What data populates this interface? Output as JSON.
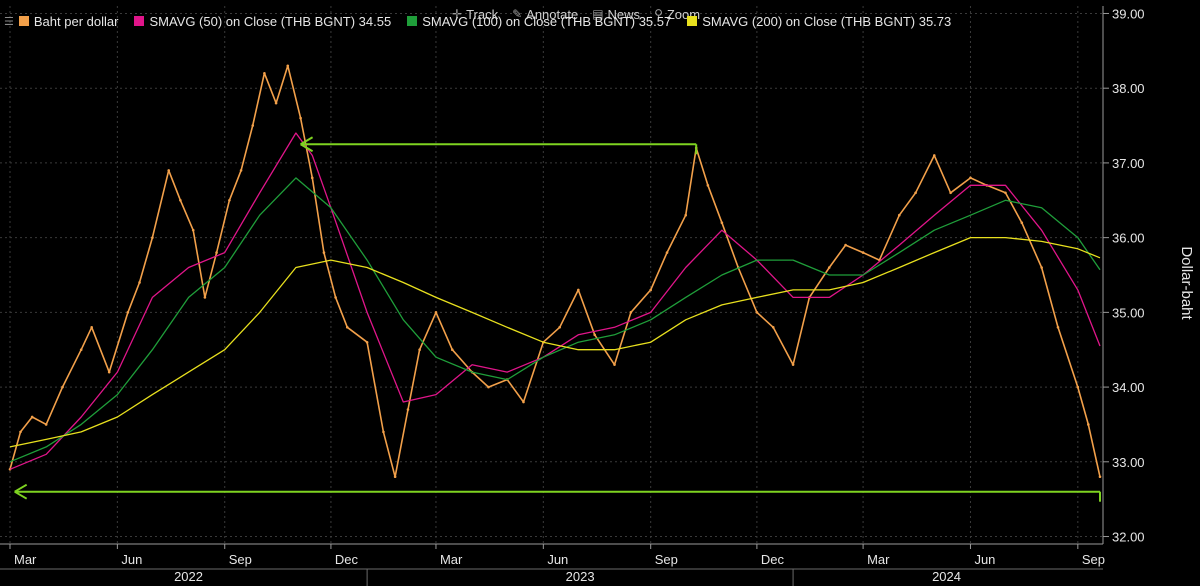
{
  "toolbar": {
    "track": "Track",
    "annotate": "Annotate",
    "news": "News",
    "zoom": "Zoom"
  },
  "legend": [
    {
      "label": "Baht per dollar",
      "color": "#f2a04a"
    },
    {
      "label": "SMAVG (50)  on Close (THB BGNT) 34.55",
      "color": "#e0158a"
    },
    {
      "label": "SMAVG (100)  on Close (THB BGNT) 35.57",
      "color": "#1f9e3a"
    },
    {
      "label": "SMAVG (200)  on Close (THB BGNT) 35.73",
      "color": "#e8e01e"
    }
  ],
  "chart_data": {
    "type": "line",
    "ylabel": "Dollar-baht",
    "ylim": [
      31.9,
      39.1
    ],
    "y_ticks": [
      "32.00",
      "33.00",
      "34.00",
      "35.00",
      "36.00",
      "37.00",
      "38.00",
      "39.00"
    ],
    "x_range": [
      "2022-03-01",
      "2024-09-20"
    ],
    "x_month_ticks": [
      {
        "date": "2022-03-01",
        "label": "Mar"
      },
      {
        "date": "2022-06-01",
        "label": "Jun"
      },
      {
        "date": "2022-09-01",
        "label": "Sep"
      },
      {
        "date": "2022-12-01",
        "label": "Dec"
      },
      {
        "date": "2023-03-01",
        "label": "Mar"
      },
      {
        "date": "2023-06-01",
        "label": "Jun"
      },
      {
        "date": "2023-09-01",
        "label": "Sep"
      },
      {
        "date": "2023-12-01",
        "label": "Dec"
      },
      {
        "date": "2024-03-01",
        "label": "Mar"
      },
      {
        "date": "2024-06-01",
        "label": "Jun"
      },
      {
        "date": "2024-09-01",
        "label": "Sep"
      }
    ],
    "x_year_labels": [
      {
        "label": "2022",
        "from": "2022-03-01",
        "to": "2023-01-01"
      },
      {
        "label": "2023",
        "from": "2023-01-01",
        "to": "2024-01-01"
      },
      {
        "label": "2024",
        "from": "2024-01-01",
        "to": "2024-09-20"
      }
    ],
    "series": [
      {
        "name": "Baht per dollar",
        "color": "#f2a04a",
        "points": [
          [
            "2022-03-01",
            32.9
          ],
          [
            "2022-03-10",
            33.4
          ],
          [
            "2022-03-20",
            33.6
          ],
          [
            "2022-04-01",
            33.5
          ],
          [
            "2022-04-15",
            34.0
          ],
          [
            "2022-05-01",
            34.5
          ],
          [
            "2022-05-10",
            34.8
          ],
          [
            "2022-05-25",
            34.2
          ],
          [
            "2022-06-10",
            35.0
          ],
          [
            "2022-06-20",
            35.4
          ],
          [
            "2022-07-01",
            36.0
          ],
          [
            "2022-07-15",
            36.9
          ],
          [
            "2022-07-25",
            36.5
          ],
          [
            "2022-08-05",
            36.1
          ],
          [
            "2022-08-15",
            35.2
          ],
          [
            "2022-08-25",
            35.8
          ],
          [
            "2022-09-05",
            36.5
          ],
          [
            "2022-09-15",
            36.9
          ],
          [
            "2022-09-25",
            37.5
          ],
          [
            "2022-10-05",
            38.2
          ],
          [
            "2022-10-15",
            37.8
          ],
          [
            "2022-10-25",
            38.3
          ],
          [
            "2022-11-05",
            37.6
          ],
          [
            "2022-11-15",
            36.8
          ],
          [
            "2022-11-25",
            35.8
          ],
          [
            "2022-12-05",
            35.2
          ],
          [
            "2022-12-15",
            34.8
          ],
          [
            "2023-01-01",
            34.6
          ],
          [
            "2023-01-15",
            33.4
          ],
          [
            "2023-01-25",
            32.8
          ],
          [
            "2023-02-05",
            33.7
          ],
          [
            "2023-02-15",
            34.5
          ],
          [
            "2023-03-01",
            35.0
          ],
          [
            "2023-03-15",
            34.5
          ],
          [
            "2023-04-01",
            34.2
          ],
          [
            "2023-04-15",
            34.0
          ],
          [
            "2023-05-01",
            34.1
          ],
          [
            "2023-05-15",
            33.8
          ],
          [
            "2023-06-01",
            34.6
          ],
          [
            "2023-06-15",
            34.8
          ],
          [
            "2023-07-01",
            35.3
          ],
          [
            "2023-07-15",
            34.7
          ],
          [
            "2023-08-01",
            34.3
          ],
          [
            "2023-08-15",
            35.0
          ],
          [
            "2023-09-01",
            35.3
          ],
          [
            "2023-09-15",
            35.8
          ],
          [
            "2023-10-01",
            36.3
          ],
          [
            "2023-10-10",
            37.2
          ],
          [
            "2023-10-20",
            36.7
          ],
          [
            "2023-11-01",
            36.2
          ],
          [
            "2023-11-15",
            35.6
          ],
          [
            "2023-12-01",
            35.0
          ],
          [
            "2023-12-15",
            34.8
          ],
          [
            "2024-01-01",
            34.3
          ],
          [
            "2024-01-15",
            35.2
          ],
          [
            "2024-02-01",
            35.6
          ],
          [
            "2024-02-15",
            35.9
          ],
          [
            "2024-03-01",
            35.8
          ],
          [
            "2024-03-15",
            35.7
          ],
          [
            "2024-04-01",
            36.3
          ],
          [
            "2024-04-15",
            36.6
          ],
          [
            "2024-05-01",
            37.1
          ],
          [
            "2024-05-15",
            36.6
          ],
          [
            "2024-06-01",
            36.8
          ],
          [
            "2024-06-15",
            36.7
          ],
          [
            "2024-07-01",
            36.6
          ],
          [
            "2024-07-15",
            36.2
          ],
          [
            "2024-08-01",
            35.6
          ],
          [
            "2024-08-15",
            34.8
          ],
          [
            "2024-09-01",
            34.0
          ],
          [
            "2024-09-10",
            33.5
          ],
          [
            "2024-09-20",
            32.8
          ]
        ]
      },
      {
        "name": "SMAVG (50)  on Close (THB BGNT) 34.55",
        "color": "#e0158a",
        "points": [
          [
            "2022-03-01",
            32.9
          ],
          [
            "2022-04-01",
            33.1
          ],
          [
            "2022-05-01",
            33.6
          ],
          [
            "2022-06-01",
            34.2
          ],
          [
            "2022-07-01",
            35.2
          ],
          [
            "2022-08-01",
            35.6
          ],
          [
            "2022-09-01",
            35.8
          ],
          [
            "2022-10-01",
            36.6
          ],
          [
            "2022-11-01",
            37.4
          ],
          [
            "2022-11-15",
            37.1
          ],
          [
            "2022-12-01",
            36.4
          ],
          [
            "2023-01-01",
            35.0
          ],
          [
            "2023-02-01",
            33.8
          ],
          [
            "2023-03-01",
            33.9
          ],
          [
            "2023-04-01",
            34.3
          ],
          [
            "2023-05-01",
            34.2
          ],
          [
            "2023-06-01",
            34.4
          ],
          [
            "2023-07-01",
            34.7
          ],
          [
            "2023-08-01",
            34.8
          ],
          [
            "2023-09-01",
            35.0
          ],
          [
            "2023-10-01",
            35.6
          ],
          [
            "2023-11-01",
            36.1
          ],
          [
            "2023-12-01",
            35.7
          ],
          [
            "2024-01-01",
            35.2
          ],
          [
            "2024-02-01",
            35.2
          ],
          [
            "2024-03-01",
            35.5
          ],
          [
            "2024-04-01",
            35.9
          ],
          [
            "2024-05-01",
            36.3
          ],
          [
            "2024-06-01",
            36.7
          ],
          [
            "2024-07-01",
            36.7
          ],
          [
            "2024-08-01",
            36.1
          ],
          [
            "2024-09-01",
            35.3
          ],
          [
            "2024-09-20",
            34.55
          ]
        ]
      },
      {
        "name": "SMAVG (100)  on Close (THB BGNT) 35.57",
        "color": "#1f9e3a",
        "points": [
          [
            "2022-03-01",
            33.0
          ],
          [
            "2022-04-01",
            33.2
          ],
          [
            "2022-05-01",
            33.5
          ],
          [
            "2022-06-01",
            33.9
          ],
          [
            "2022-07-01",
            34.5
          ],
          [
            "2022-08-01",
            35.2
          ],
          [
            "2022-09-01",
            35.6
          ],
          [
            "2022-10-01",
            36.3
          ],
          [
            "2022-11-01",
            36.8
          ],
          [
            "2022-12-01",
            36.4
          ],
          [
            "2023-01-01",
            35.7
          ],
          [
            "2023-02-01",
            34.9
          ],
          [
            "2023-03-01",
            34.4
          ],
          [
            "2023-04-01",
            34.2
          ],
          [
            "2023-05-01",
            34.1
          ],
          [
            "2023-06-01",
            34.4
          ],
          [
            "2023-07-01",
            34.6
          ],
          [
            "2023-08-01",
            34.7
          ],
          [
            "2023-09-01",
            34.9
          ],
          [
            "2023-10-01",
            35.2
          ],
          [
            "2023-11-01",
            35.5
          ],
          [
            "2023-12-01",
            35.7
          ],
          [
            "2024-01-01",
            35.7
          ],
          [
            "2024-02-01",
            35.5
          ],
          [
            "2024-03-01",
            35.5
          ],
          [
            "2024-04-01",
            35.8
          ],
          [
            "2024-05-01",
            36.1
          ],
          [
            "2024-06-01",
            36.3
          ],
          [
            "2024-07-01",
            36.5
          ],
          [
            "2024-08-01",
            36.4
          ],
          [
            "2024-09-01",
            36.0
          ],
          [
            "2024-09-20",
            35.57
          ]
        ]
      },
      {
        "name": "SMAVG (200)  on Close (THB BGNT) 35.73",
        "color": "#e8e01e",
        "points": [
          [
            "2022-03-01",
            33.2
          ],
          [
            "2022-04-01",
            33.3
          ],
          [
            "2022-05-01",
            33.4
          ],
          [
            "2022-06-01",
            33.6
          ],
          [
            "2022-07-01",
            33.9
          ],
          [
            "2022-08-01",
            34.2
          ],
          [
            "2022-09-01",
            34.5
          ],
          [
            "2022-10-01",
            35.0
          ],
          [
            "2022-11-01",
            35.6
          ],
          [
            "2022-12-01",
            35.7
          ],
          [
            "2023-01-01",
            35.6
          ],
          [
            "2023-02-01",
            35.4
          ],
          [
            "2023-03-01",
            35.2
          ],
          [
            "2023-04-01",
            35.0
          ],
          [
            "2023-05-01",
            34.8
          ],
          [
            "2023-06-01",
            34.6
          ],
          [
            "2023-07-01",
            34.5
          ],
          [
            "2023-08-01",
            34.5
          ],
          [
            "2023-09-01",
            34.6
          ],
          [
            "2023-10-01",
            34.9
          ],
          [
            "2023-11-01",
            35.1
          ],
          [
            "2023-12-01",
            35.2
          ],
          [
            "2024-01-01",
            35.3
          ],
          [
            "2024-02-01",
            35.3
          ],
          [
            "2024-03-01",
            35.4
          ],
          [
            "2024-04-01",
            35.6
          ],
          [
            "2024-05-01",
            35.8
          ],
          [
            "2024-06-01",
            36.0
          ],
          [
            "2024-07-01",
            36.0
          ],
          [
            "2024-08-01",
            35.95
          ],
          [
            "2024-09-01",
            35.85
          ],
          [
            "2024-09-20",
            35.73
          ]
        ]
      }
    ],
    "annotations": [
      {
        "type": "arrow",
        "color": "#7ed321",
        "from": [
          "2023-10-10",
          37.25
        ],
        "to": [
          "2022-11-05",
          37.25
        ]
      },
      {
        "type": "arrow",
        "color": "#7ed321",
        "from": [
          "2024-09-20",
          32.6
        ],
        "to": [
          "2022-03-05",
          32.6
        ]
      }
    ]
  }
}
